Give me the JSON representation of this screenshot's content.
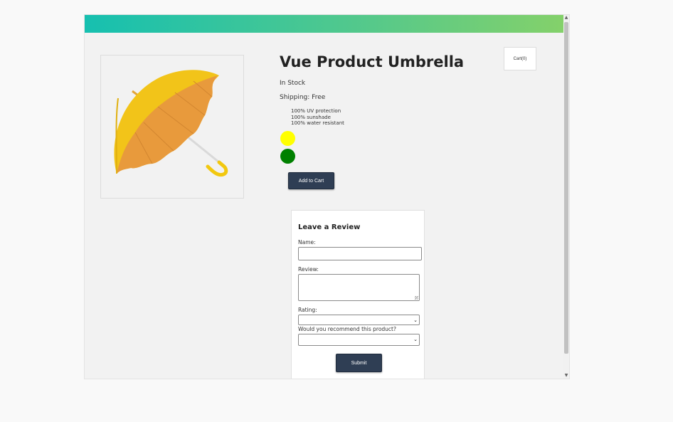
{
  "product": {
    "title": "Vue Product Umbrella",
    "stock_status": "In Stock",
    "shipping_label": "Shipping:",
    "shipping_value": "Free",
    "details": [
      "100% UV protection",
      "100% sunshade",
      "100% water resistant"
    ],
    "variants": [
      {
        "color": "yellow",
        "hex": "#ffff00"
      },
      {
        "color": "green",
        "hex": "#008000"
      }
    ],
    "image_subject": "yellow umbrella"
  },
  "cart": {
    "label": "Cart(0)"
  },
  "actions": {
    "add_to_cart_label": "Add to Cart"
  },
  "review_form": {
    "title": "Leave a Review",
    "name_label": "Name:",
    "name_value": "",
    "review_label": "Review:",
    "review_value": "",
    "rating_label": "Rating:",
    "rating_selected": "",
    "recommend_label": "Would you recommend this product?",
    "recommend_selected": "",
    "submit_label": "Submit"
  },
  "theme": {
    "header_gradient_start": "#16c0b0",
    "header_gradient_end": "#84d16a",
    "button_color": "#2f3e54"
  }
}
